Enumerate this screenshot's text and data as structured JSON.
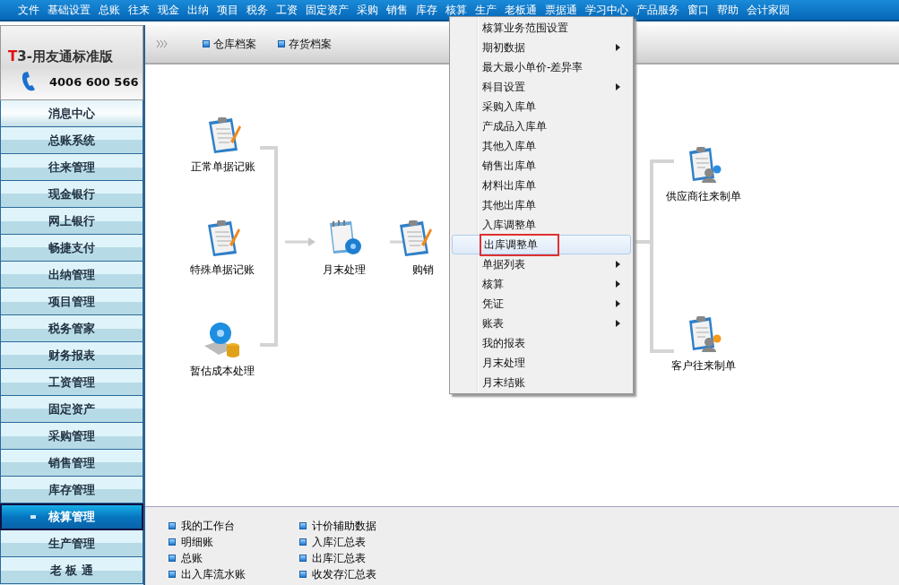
{
  "menu_bar": [
    "文件",
    "基础设置",
    "总账",
    "往来",
    "现金",
    "出纳",
    "项目",
    "税务",
    "工资",
    "固定资产",
    "采购",
    "销售",
    "库存",
    "核算",
    "生产",
    "老板通",
    "票据通",
    "学习中心",
    "产品服务",
    "窗口",
    "帮助",
    "会计家园"
  ],
  "logo": {
    "mark": "T",
    "text": "3-用友通标准版"
  },
  "phone": "4006 600 566",
  "sidebar": [
    {
      "label": "消息中心",
      "selected": false,
      "kind": "top"
    },
    {
      "label": "总账系统",
      "selected": false
    },
    {
      "label": "往来管理",
      "selected": false
    },
    {
      "label": "现金银行",
      "selected": false
    },
    {
      "label": "网上银行",
      "selected": false
    },
    {
      "label": "畅捷支付",
      "selected": false
    },
    {
      "label": "出纳管理",
      "selected": false
    },
    {
      "label": "项目管理",
      "selected": false
    },
    {
      "label": "税务管家",
      "selected": false
    },
    {
      "label": "财务报表",
      "selected": false
    },
    {
      "label": "工资管理",
      "selected": false
    },
    {
      "label": "固定资产",
      "selected": false
    },
    {
      "label": "采购管理",
      "selected": false
    },
    {
      "label": "销售管理",
      "selected": false
    },
    {
      "label": "库存管理",
      "selected": false
    },
    {
      "label": "核算管理",
      "selected": true
    },
    {
      "label": "生产管理",
      "selected": false
    },
    {
      "label": "老 板 通",
      "selected": false
    }
  ],
  "toolbar_links": [
    "仓库档案",
    "存货档案"
  ],
  "flow_nodes": [
    {
      "label": "正常单据记账",
      "kind": "clipboard"
    },
    {
      "label": "特殊单据记账",
      "kind": "clipboard"
    },
    {
      "label": "暂估成本处理",
      "kind": "gear"
    },
    {
      "label": "月末处理",
      "kind": "calendar"
    },
    {
      "label": "购销",
      "kind": "clipboard"
    },
    {
      "label": "供应商往来制单",
      "kind": "people"
    },
    {
      "label": "客户往来制单",
      "kind": "people"
    }
  ],
  "context_menu": [
    {
      "label": "核算业务范围设置",
      "submenu": false,
      "selected": false
    },
    {
      "label": "期初数据",
      "submenu": true,
      "selected": false
    },
    {
      "label": "最大最小单价-差异率",
      "submenu": false,
      "selected": false
    },
    {
      "label": "科目设置",
      "submenu": true,
      "selected": false
    },
    {
      "label": "采购入库单",
      "submenu": false,
      "selected": false
    },
    {
      "label": "产成品入库单",
      "submenu": false,
      "selected": false
    },
    {
      "label": "其他入库单",
      "submenu": false,
      "selected": false
    },
    {
      "label": "销售出库单",
      "submenu": false,
      "selected": false
    },
    {
      "label": "材料出库单",
      "submenu": false,
      "selected": false
    },
    {
      "label": "其他出库单",
      "submenu": false,
      "selected": false
    },
    {
      "label": "入库调整单",
      "submenu": false,
      "selected": false
    },
    {
      "label": "出库调整单",
      "submenu": false,
      "selected": true
    },
    {
      "label": "单据列表",
      "submenu": true,
      "selected": false
    },
    {
      "label": "核算",
      "submenu": true,
      "selected": false
    },
    {
      "label": "凭证",
      "submenu": true,
      "selected": false
    },
    {
      "label": "账表",
      "submenu": true,
      "selected": false
    },
    {
      "label": "我的报表",
      "submenu": false,
      "selected": false
    },
    {
      "label": "月末处理",
      "submenu": false,
      "selected": false
    },
    {
      "label": "月末结账",
      "submenu": false,
      "selected": false
    }
  ],
  "bottom_links": [
    [
      "我的工作台",
      "明细账",
      "总账",
      "出入库流水账"
    ],
    [
      "计价辅助数据",
      "入库汇总表",
      "出库汇总表",
      "收发存汇总表"
    ]
  ]
}
